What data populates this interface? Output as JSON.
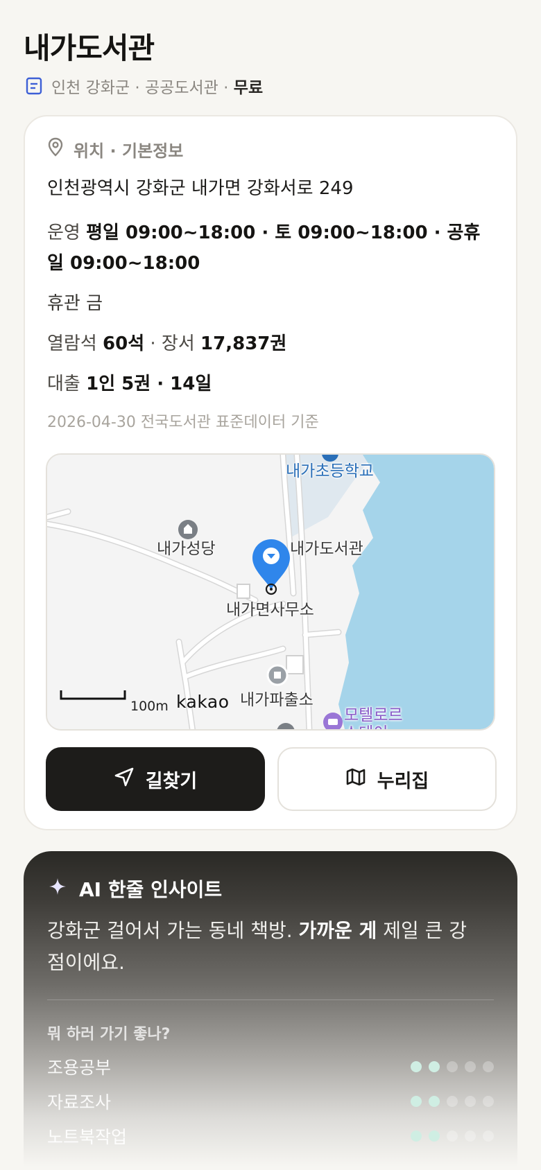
{
  "library": {
    "name": "내가도서관",
    "region": "인천 강화군 · 공공도서관 · ",
    "fee": "무료"
  },
  "info": {
    "section_title": "위치 · 기본정보",
    "address": "인천광역시 강화군 내가면 강화서로 249",
    "hours_label": "운영",
    "hours_value": "평일 09:00~18:00 · 토 09:00~18:00 · 공휴일 09:00~18:00",
    "closed_label": "휴관",
    "closed_value": "금",
    "seats_label": "열람석",
    "seats_value": "60석",
    "books_label": " · 장서 ",
    "books_value": "17,837권",
    "loan_label": "대출",
    "loan_value": "1인 5권 · 14일",
    "basis": "2026-04-30 전국도서관 표준데이터 기준"
  },
  "map": {
    "labels": {
      "school": "내가초등학교",
      "church": "내가성당",
      "library": "내가도서관",
      "office": "내가면사무소",
      "police": "내가파출소",
      "motel_line1": "모텔로르",
      "motel_line2": "스테이"
    },
    "scale": "100m",
    "brand": "kakao",
    "colors": {
      "water": "#a5d4ea",
      "marker": "#2f86eb"
    }
  },
  "actions": {
    "directions": "길찾기",
    "nurijip": "누리집"
  },
  "ai": {
    "title": "AI 한줄 인사이트",
    "text_a": "강화군 걸어서 가는 동네 책방. ",
    "text_b": "가까운 게",
    "text_c": " 제일 큰 강점이에요.",
    "question": "뭐 하러 가기 좋나?",
    "uses": [
      {
        "name": "조용공부",
        "score": 2,
        "max": 5
      },
      {
        "name": "자료조사",
        "score": 2,
        "max": 5
      },
      {
        "name": "노트북작업",
        "score": 2,
        "max": 5
      }
    ]
  }
}
